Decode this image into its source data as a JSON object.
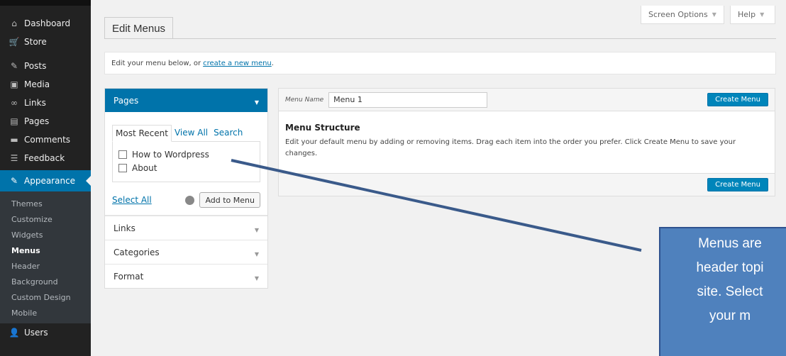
{
  "sidebar": {
    "items": [
      {
        "label": "Dashboard",
        "icon": "home-icon",
        "glyph": "⌂"
      },
      {
        "label": "Store",
        "icon": "cart-icon",
        "glyph": "🛒"
      },
      {
        "label": "Posts",
        "icon": "pin-icon",
        "glyph": "✎"
      },
      {
        "label": "Media",
        "icon": "media-icon",
        "glyph": "▣"
      },
      {
        "label": "Links",
        "icon": "link-icon",
        "glyph": "∞"
      },
      {
        "label": "Pages",
        "icon": "page-icon",
        "glyph": "▤"
      },
      {
        "label": "Comments",
        "icon": "comment-icon",
        "glyph": "▬"
      },
      {
        "label": "Feedback",
        "icon": "feedback-icon",
        "glyph": "☰"
      }
    ],
    "active": {
      "label": "Appearance",
      "icon": "paintbrush-icon",
      "glyph": "✎"
    },
    "submenu": [
      "Themes",
      "Customize",
      "Widgets",
      "Menus",
      "Header",
      "Background",
      "Custom Design",
      "Mobile"
    ],
    "current_submenu": "Menus",
    "after": {
      "label": "Users",
      "icon": "users-icon",
      "glyph": "👤"
    }
  },
  "top_tabs": {
    "screen_options": "Screen Options",
    "help": "Help"
  },
  "page_title": "Edit Menus",
  "notice": {
    "text": "Edit your menu below, or",
    "link": "create a new menu",
    "suffix": "."
  },
  "accordion": {
    "open_section": "Pages",
    "tabs": [
      "Most Recent",
      "View All",
      "Search"
    ],
    "active_tab": "Most Recent",
    "items": [
      "How to Wordpress",
      "About"
    ],
    "select_all": "Select All",
    "add_button": "Add to Menu",
    "sections": [
      "Links",
      "Categories",
      "Format"
    ]
  },
  "menu_editor": {
    "name_label": "Menu Name",
    "name_value": "Menu 1",
    "create_button": "Create Menu",
    "structure_title": "Menu Structure",
    "structure_desc": "Edit your default menu by adding or removing items. Drag each item into the order you prefer. Click Create Menu to save your changes."
  },
  "callout": {
    "lines": [
      "Menus are",
      "header topi",
      "site.  Select",
      "your m"
    ]
  },
  "colors": {
    "accent": "#0073aa",
    "callout": "#4f81bd",
    "sidebar": "#222222"
  }
}
